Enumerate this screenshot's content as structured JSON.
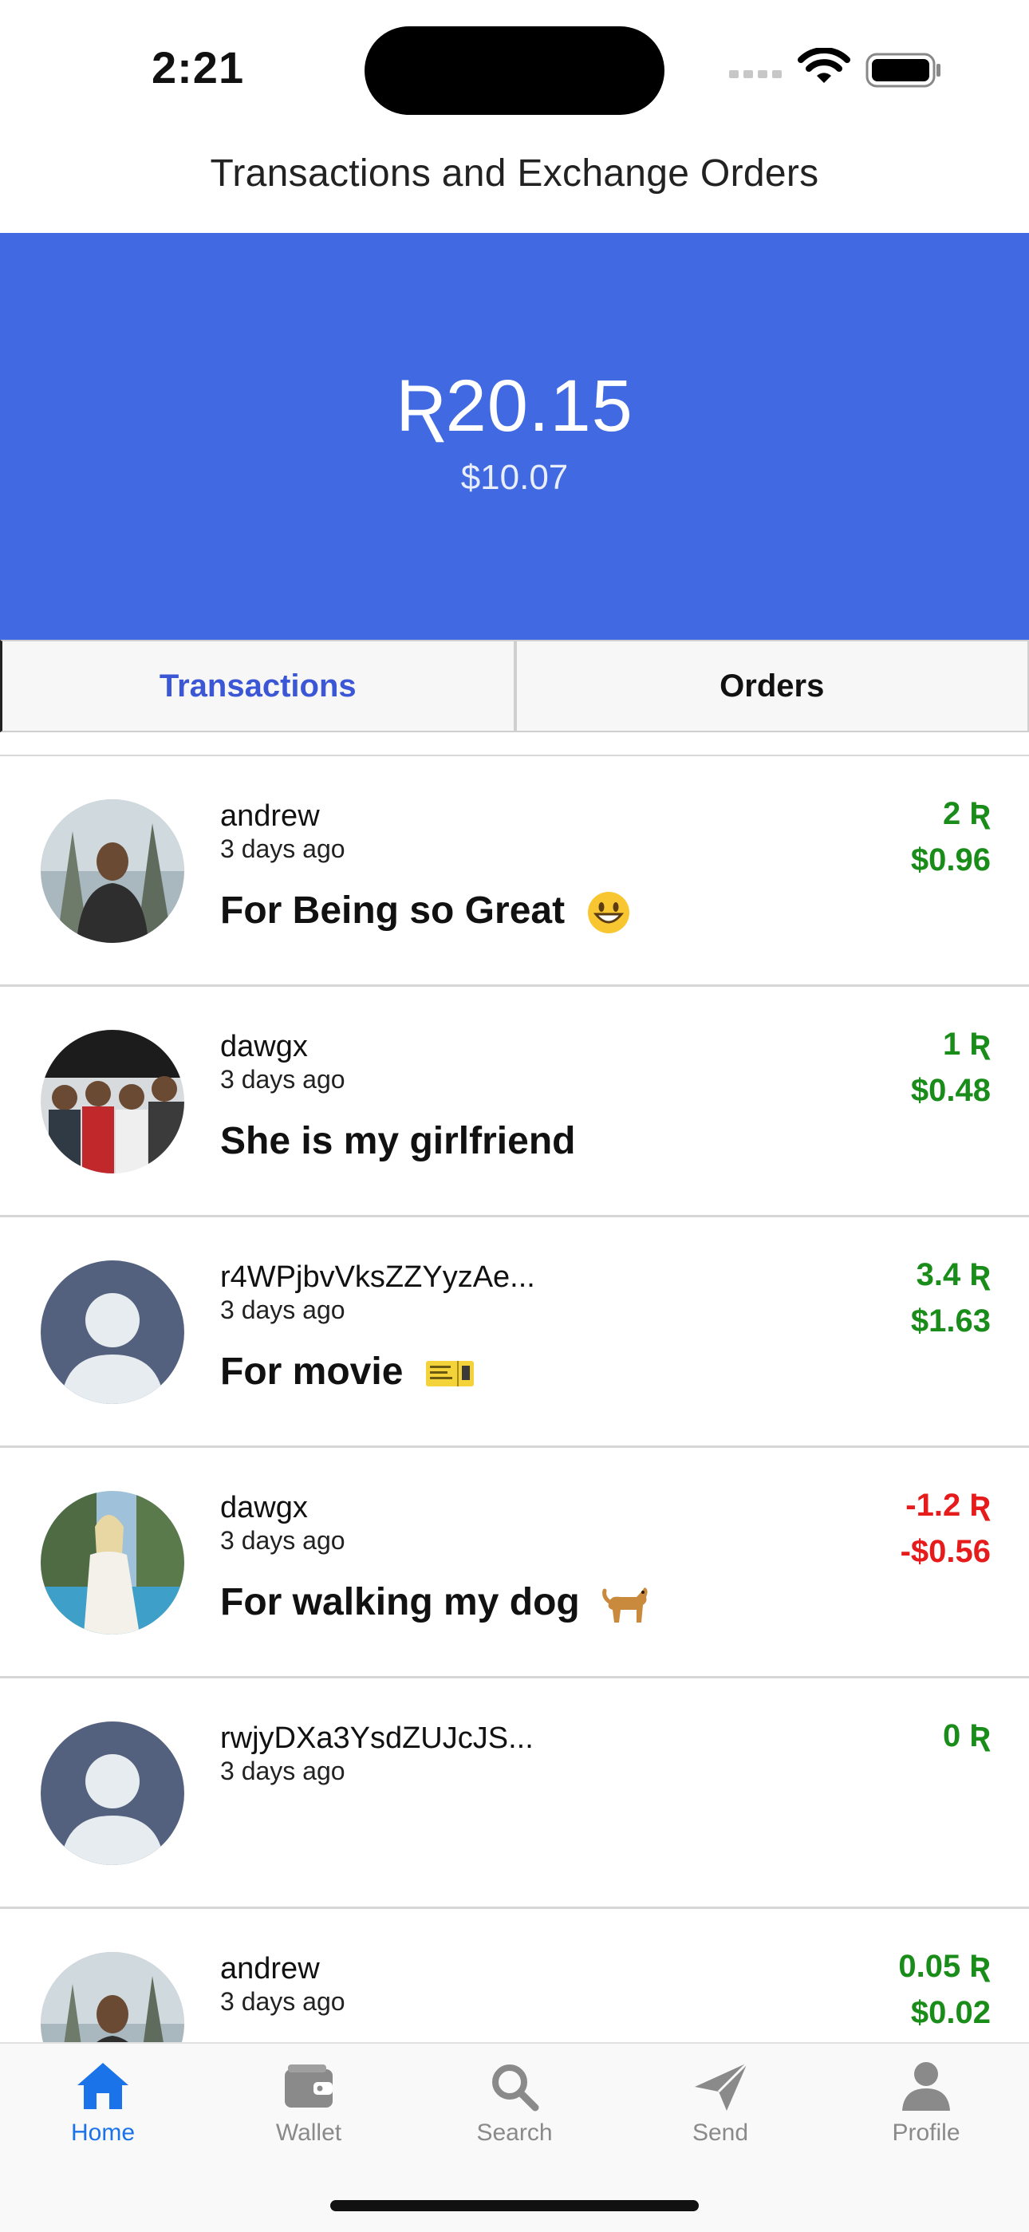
{
  "status_bar": {
    "time": "2:21"
  },
  "header": {
    "title": "Transactions and Exchange Orders"
  },
  "balance": {
    "primary": "Ʀ20.15",
    "secondary": "$10.07"
  },
  "tabs": [
    {
      "label": "Transactions",
      "active": true
    },
    {
      "label": "Orders",
      "active": false
    }
  ],
  "transactions": [
    {
      "name": "andrew",
      "time": "3 days ago",
      "memo": "For Being so Great",
      "emoji": "grinning-face-emoji",
      "amount_rich": "2 Ʀ",
      "amount_usd": "$0.96",
      "direction": "positive",
      "avatar": "photo-person-trees"
    },
    {
      "name": "dawgx",
      "time": "3 days ago",
      "memo": "She is my girlfriend",
      "emoji": "",
      "amount_rich": "1 Ʀ",
      "amount_usd": "$0.48",
      "direction": "positive",
      "avatar": "photo-group"
    },
    {
      "name": "r4WPjbvVksZZYyzAe...",
      "time": "3 days ago",
      "memo": "For movie",
      "emoji": "ticket-emoji",
      "amount_rich": "3.4 Ʀ",
      "amount_usd": "$1.63",
      "direction": "positive",
      "avatar": "default-person-icon"
    },
    {
      "name": "dawgx",
      "time": "3 days ago",
      "memo": "For walking my dog",
      "emoji": "dog-emoji",
      "amount_rich": "-1.2 Ʀ",
      "amount_usd": "-$0.56",
      "direction": "negative",
      "avatar": "photo-woman"
    },
    {
      "name": "rwjyDXa3YsdZUJcJS...",
      "time": "3 days ago",
      "memo": "",
      "emoji": "",
      "amount_rich": "0 Ʀ",
      "amount_usd": "",
      "direction": "positive",
      "avatar": "default-person-icon"
    },
    {
      "name": "andrew",
      "time": "3 days ago",
      "memo": "",
      "emoji": "",
      "amount_rich": "0.05 Ʀ",
      "amount_usd": "$0.02",
      "direction": "positive",
      "avatar": "photo-person-trees"
    }
  ],
  "tabbar": [
    {
      "label": "Home",
      "icon": "house-icon",
      "active": true
    },
    {
      "label": "Wallet",
      "icon": "wallet-icon",
      "active": false
    },
    {
      "label": "Search",
      "icon": "magnifier-icon",
      "active": false
    },
    {
      "label": "Send",
      "icon": "paper-plane-icon",
      "active": false
    },
    {
      "label": "Profile",
      "icon": "person-icon",
      "active": false
    }
  ],
  "colors": {
    "banner": "#4169e1",
    "active_tab": "#3b57d6",
    "positive": "#198c19",
    "negative": "#e61c1c",
    "tabbar_active": "#1a73e8",
    "tabbar_inactive": "#8a8a8a"
  }
}
